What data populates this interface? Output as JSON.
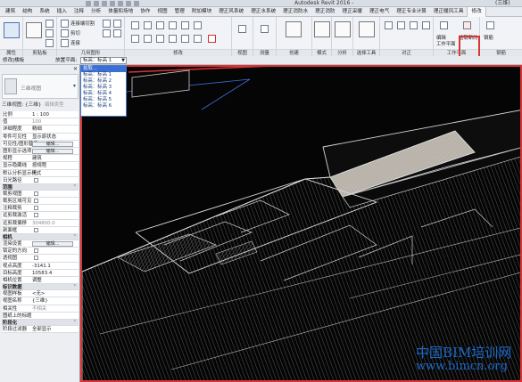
{
  "title_bar": {
    "app_title": "Autodesk Revit 2016 -",
    "suffix": "(三维)"
  },
  "ribbon_tabs": [
    "建筑",
    "结构",
    "系统",
    "插入",
    "注释",
    "分析",
    "体量和场地",
    "协作",
    "视图",
    "管理",
    "附加模块",
    "理正风系统",
    "理正水系统",
    "理正消防水",
    "理正消防",
    "理正采暖",
    "理正电气",
    "理正专业计算",
    "理正暖风工具",
    "修改"
  ],
  "ribbon": {
    "groups": [
      {
        "label": "属性"
      },
      {
        "label": "剪贴板"
      },
      {
        "label": "几何图形"
      },
      {
        "label": "修改"
      },
      {
        "label": "视图"
      },
      {
        "label": "测量"
      },
      {
        "label": "创建"
      },
      {
        "label": "模式"
      },
      {
        "label": "分析"
      },
      {
        "label": "选择工具"
      },
      {
        "label": "对正"
      },
      {
        "label": "工作平面"
      },
      {
        "label": "钢筋"
      }
    ],
    "clipboard_connect_label": "连接",
    "geometry_cut_label": "连接端切割",
    "geometry_cut2_label": "剪切",
    "geometry_join_label": "连接",
    "workplane_btn1": "编辑",
    "workplane_btn2": "工作平面",
    "workplane_btn3": "拾取新的",
    "rebar_btn1": "钢筋"
  },
  "options_bar": {
    "modify_label": "修改|楼板",
    "placement_label": "放置平面:",
    "selected_level": "标高：标高 1",
    "level_options": [
      "拾取...",
      "标高：标高 1",
      "标高：标高 2",
      "标高：标高 3",
      "标高：标高 4",
      "标高：标高 5",
      "标高：标高 6"
    ]
  },
  "properties": {
    "type_name": "三维视图",
    "instance_label": "三维视图: {三维}",
    "edit_type": "编辑类型",
    "rows": [
      {
        "key": "比例",
        "value": "1 : 100"
      },
      {
        "key": "值",
        "value": "100",
        "dim": true
      },
      {
        "key": "详细程度",
        "value": "精细"
      },
      {
        "key": "零件可见性",
        "value": "显示原状态"
      },
      {
        "key": "可见性/图形替换",
        "button": "编辑..."
      },
      {
        "key": "图形显示选项",
        "button": "编辑..."
      },
      {
        "key": "规程",
        "value": "建筑"
      },
      {
        "key": "显示隐藏线",
        "value": "按规程"
      },
      {
        "key": "默认分析显示样式",
        "value": "无"
      },
      {
        "key": "日光路径",
        "checkbox": true
      },
      {
        "section": "范围"
      },
      {
        "key": "裁剪视图",
        "checkbox": true
      },
      {
        "key": "裁剪区域可见",
        "checkbox": true
      },
      {
        "key": "注释裁剪",
        "checkbox": true
      },
      {
        "key": "远剪裁激活",
        "checkbox": true
      },
      {
        "key": "远剪裁偏移",
        "value": "304800.0",
        "dim": true
      },
      {
        "key": "剖面框",
        "checkbox": true
      },
      {
        "section": "相机"
      },
      {
        "key": "渲染设置",
        "button": "编辑..."
      },
      {
        "key": "锁定的方向",
        "checkbox": true
      },
      {
        "key": "透视图",
        "checkbox": true
      },
      {
        "key": "视点高度",
        "value": "-3141.1"
      },
      {
        "key": "目标高度",
        "value": "10583.4"
      },
      {
        "key": "相机位置",
        "value": "调整"
      },
      {
        "section": "标识数据"
      },
      {
        "key": "视图样板",
        "value": "<无>"
      },
      {
        "key": "视图名称",
        "value": "{三维}"
      },
      {
        "key": "相关性",
        "value": "不相关",
        "dim": true
      },
      {
        "key": "图纸上的标题",
        "value": ""
      },
      {
        "section": "阶段化"
      },
      {
        "key": "阶段过滤器",
        "value": "全部显示"
      }
    ]
  },
  "watermark": {
    "line1": "中国BIM培训网",
    "line2": "www.bimcn.org"
  }
}
